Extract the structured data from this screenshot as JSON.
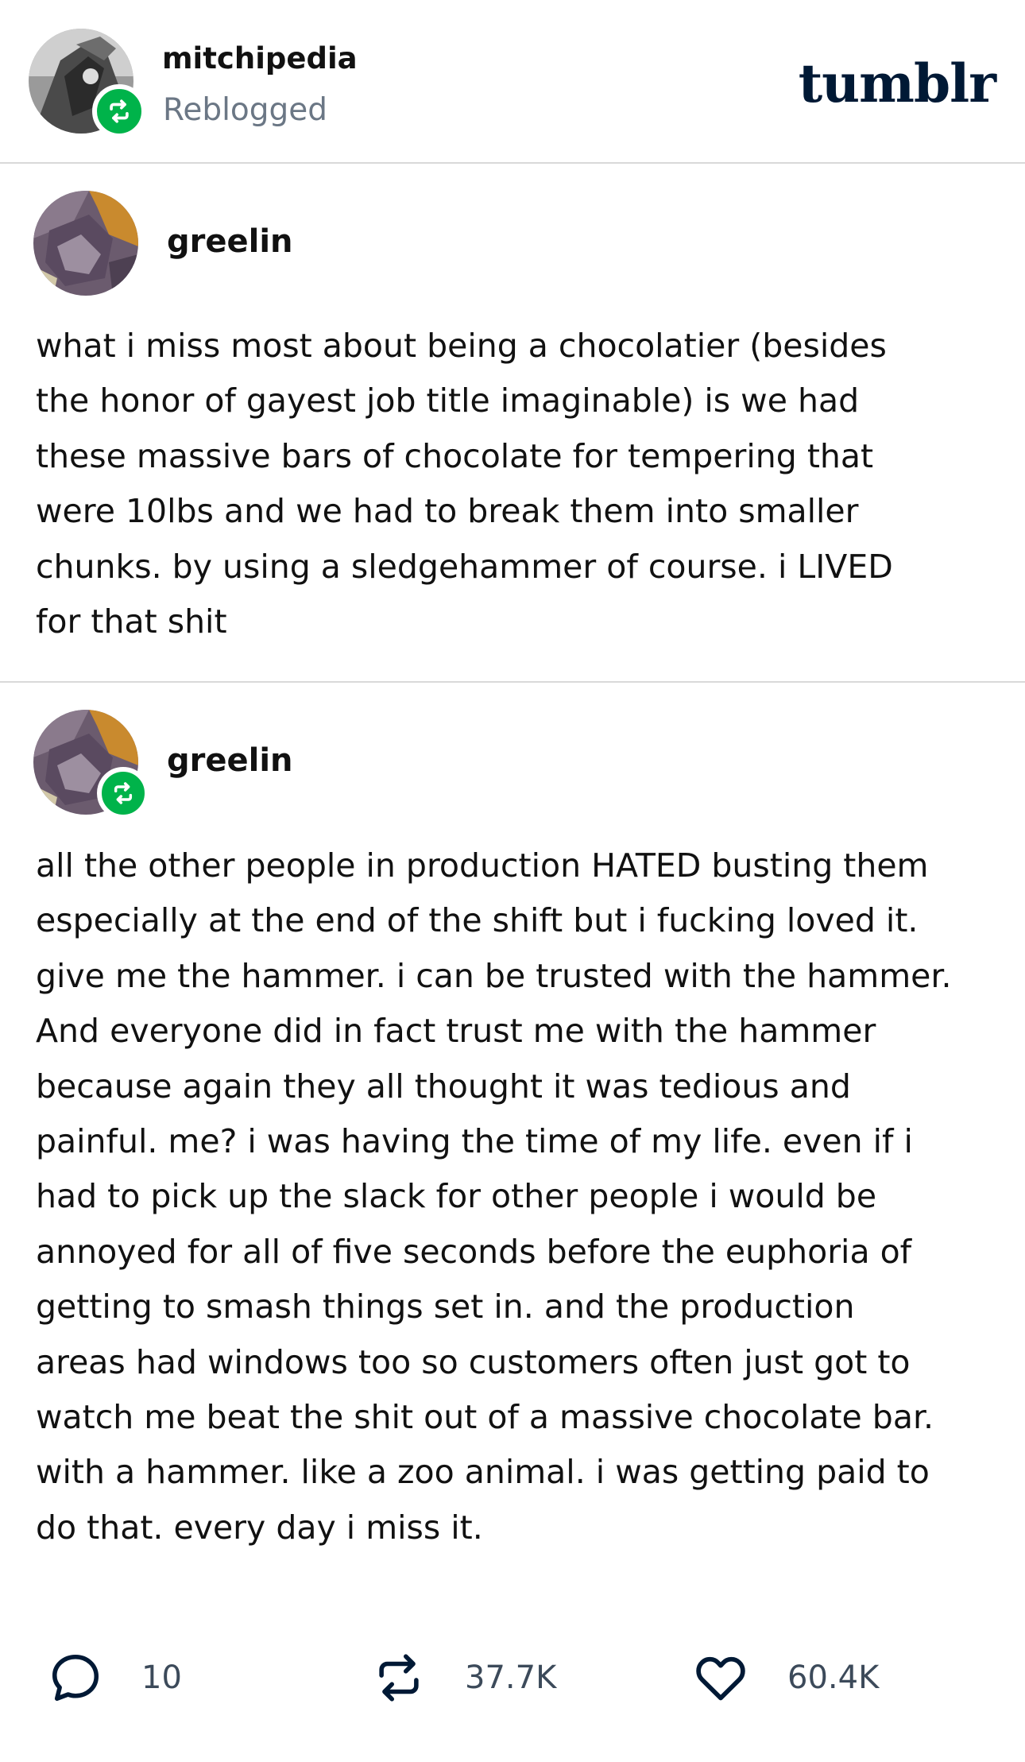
{
  "header": {
    "username": "mitchipedia",
    "status": "Reblogged",
    "logo": "tumblr",
    "reblog_icon": "reblog-icon"
  },
  "posts": [
    {
      "username": "greelin",
      "text": "what i miss most about being a chocolatier (besides\nthe honor of gayest job title imaginable) is we had\nthese massive bars of chocolate for tempering that\nwere 10lbs and we had to break them into smaller\nchunks. by using a sledgehammer of course. i LIVED\nfor that shit"
    },
    {
      "username": "greelin",
      "reblog_icon": "reblog-icon",
      "text": "all the other people in production HATED busting them\nespecially at the end of the shift but i fucking loved it.\ngive me the hammer. i can be trusted with the hammer.\nAnd everyone did in fact trust me with the hammer\nbecause again they all thought it was tedious and\npainful. me? i was having the time of my life. even if i\nhad to pick up the slack for other people i would be\nannoyed for all of five seconds before the euphoria of\ngetting to smash things set in. and the production\nareas had windows too so customers often just got to\nwatch me beat the shit out of a massive chocolate bar.\nwith a hammer. like a zoo animal. i was getting paid to\ndo that. every day i miss it."
    }
  ],
  "footer": {
    "comments": {
      "icon": "comment-icon",
      "count": "10"
    },
    "reblogs": {
      "icon": "reblog-icon",
      "count": "37.7K"
    },
    "likes": {
      "icon": "heart-icon",
      "count": "60.4K"
    }
  },
  "colors": {
    "reblog_green": "#00b34a",
    "logo_navy": "#001935",
    "muted_text": "#6b7785",
    "divider": "#d9d9d9"
  }
}
